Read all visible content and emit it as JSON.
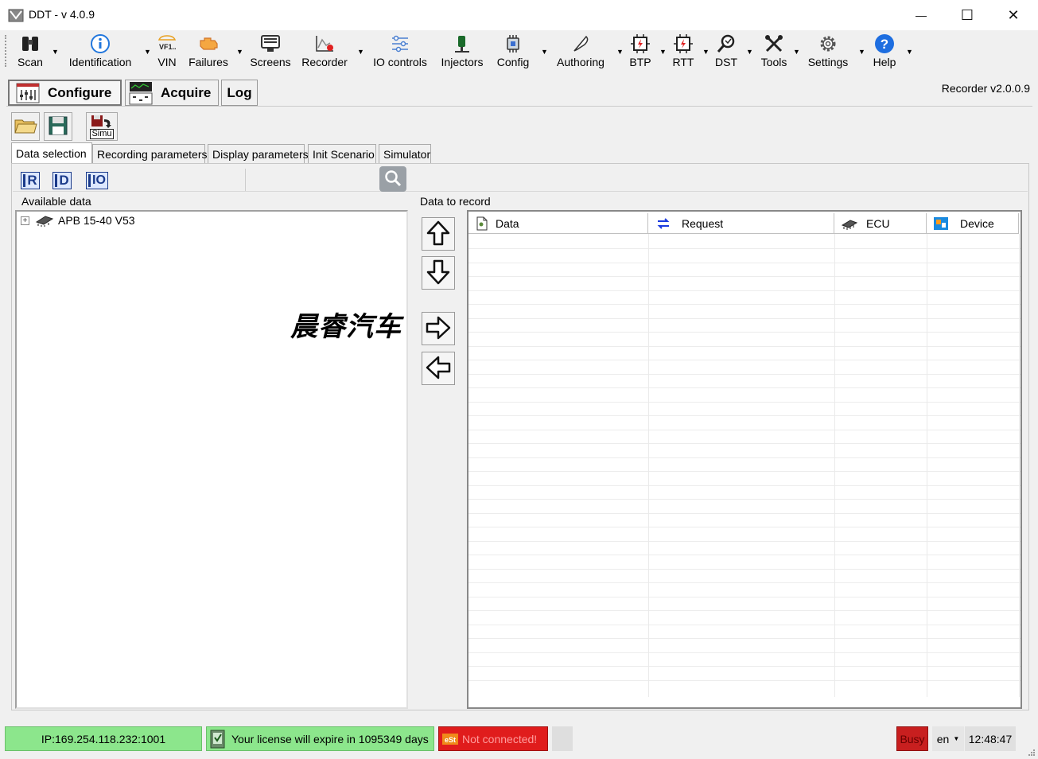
{
  "window": {
    "title": "DDT - v 4.0.9",
    "minimize": "—",
    "maximize": "☐",
    "close": "✕"
  },
  "toolbar": [
    {
      "label": "Scan",
      "icon": "binoculars-icon"
    },
    {
      "label": "Identification",
      "icon": "info-icon"
    },
    {
      "label": "VIN",
      "icon": "vin-car-icon"
    },
    {
      "label": "Failures",
      "icon": "engine-warning-icon"
    },
    {
      "label": "Screens",
      "icon": "screens-icon"
    },
    {
      "label": "Recorder",
      "icon": "recorder-chart-icon"
    },
    {
      "label": "IO controls",
      "icon": "sliders-icon"
    },
    {
      "label": "Injectors",
      "icon": "injector-icon"
    },
    {
      "label": "Config",
      "icon": "chip-config-icon"
    },
    {
      "label": "Authoring",
      "icon": "feather-pen-icon"
    },
    {
      "label": "BTP",
      "icon": "btp-chip-icon"
    },
    {
      "label": "RTT",
      "icon": "rtt-chip-icon"
    },
    {
      "label": "DST",
      "icon": "dst-magnifier-icon"
    },
    {
      "label": "Tools",
      "icon": "tools-icon"
    },
    {
      "label": "Settings",
      "icon": "gear-icon"
    },
    {
      "label": "Help",
      "icon": "help-icon"
    }
  ],
  "mode_tabs": {
    "configure": "Configure",
    "acquire": "Acquire",
    "log": "Log"
  },
  "recorder_version": "Recorder v2.0.0.9",
  "file_buttons": {
    "simu": "Simu"
  },
  "sub_tabs": [
    "Data selection",
    "Recording parameters",
    "Display parameters",
    "Init Scenario",
    "Simulator"
  ],
  "id_buttons": [
    "R",
    "D",
    "IO"
  ],
  "available": {
    "label": "Available data",
    "tree_item": "APB 15-40 V53",
    "expander": "+"
  },
  "record": {
    "label": "Data to record",
    "columns": [
      "Data",
      "Request",
      "ECU",
      "Device"
    ]
  },
  "watermark": "晨睿汽车",
  "status": {
    "ip": "IP:169.254.118.232:1001",
    "license": "Your license will expire in 1095349 days",
    "connection": "Not connected!",
    "busy": "Busy",
    "language": "en",
    "time": "12:48:47"
  },
  "colors": {
    "ip_bg": "#8ce68c",
    "license_bg": "#8ce68c",
    "connection_bg": "#e01c1c",
    "busy_bg": "#c81f1f"
  }
}
